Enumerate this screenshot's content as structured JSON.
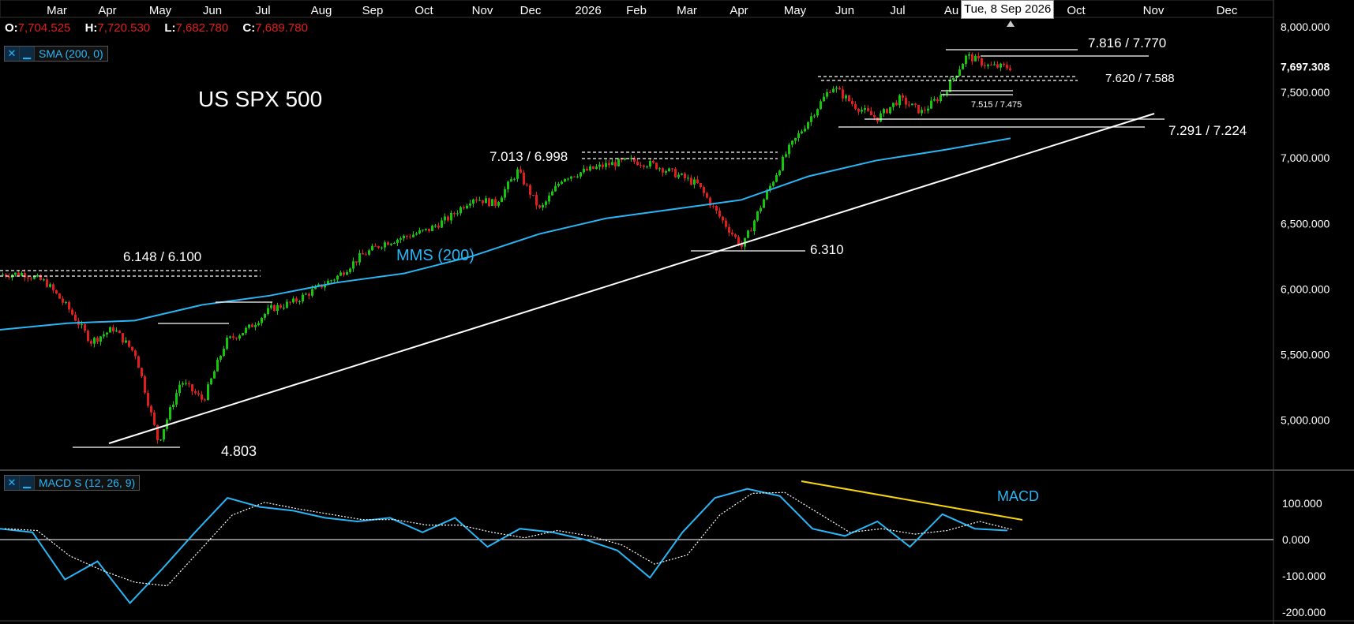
{
  "ohlc": {
    "o_label": "O:",
    "o": "7,704.525",
    "h_label": "H:",
    "h": "7,720.530",
    "l_label": "L:",
    "l": "7,682.780",
    "c_label": "C:",
    "c": "7,689.780"
  },
  "indicators": {
    "sma_label": "SMA (200, 0)",
    "macd_label": "MACD S (12, 26, 9)",
    "close_icon": "close-icon",
    "minimize_icon": "minimize-icon"
  },
  "crosshair_date": "Tue, 8 Sep 2026",
  "colors": {
    "up": "#16c60c",
    "down": "#e01e1e",
    "sma": "#29b6f6",
    "macd": "#29b6f6",
    "trend": "#ffffff",
    "divergence": "#f5d40f"
  },
  "chart_data": [
    {
      "type": "candlestick",
      "title": "US SPX 500",
      "x_ticks": [
        "Mar",
        "Apr",
        "May",
        "Jun",
        "Jul",
        "Aug",
        "Sep",
        "Oct",
        "Nov",
        "Dec",
        "2026",
        "Feb",
        "Mar",
        "Apr",
        "May",
        "Jun",
        "Jul",
        "Au",
        "Oct",
        "Nov",
        "Dec"
      ],
      "y_ticks": [
        "8,000.000",
        "7,697.308",
        "7,500.000",
        "7,000.000",
        "6,500.000",
        "6,000.000",
        "5,500.000",
        "5,000.000"
      ],
      "last_price": 7697.308,
      "ylim": [
        4730,
        8080
      ],
      "sma_label": "MMS (200)",
      "price_path": [
        [
          "Mar",
          6110
        ],
        [
          "Mar",
          6120
        ],
        [
          "Mar",
          6050
        ],
        [
          "Mar",
          5850
        ],
        [
          "Mar",
          5600
        ],
        [
          "Apr",
          5700
        ],
        [
          "Apr",
          5500
        ],
        [
          "Apr",
          4830
        ],
        [
          "Apr",
          5300
        ],
        [
          "Apr",
          5150
        ],
        [
          "May",
          5600
        ],
        [
          "May",
          5700
        ],
        [
          "May",
          5850
        ],
        [
          "Jun",
          5900
        ],
        [
          "Jun",
          6000
        ],
        [
          "Jul",
          6100
        ],
        [
          "Jul",
          6250
        ],
        [
          "Aug",
          6350
        ],
        [
          "Aug",
          6400
        ],
        [
          "Sep",
          6450
        ],
        [
          "Sep",
          6550
        ],
        [
          "Oct",
          6700
        ],
        [
          "Oct",
          6650
        ],
        [
          "Nov",
          6900
        ],
        [
          "Nov",
          6600
        ],
        [
          "Dec",
          6850
        ],
        [
          "Dec",
          6900
        ],
        [
          "2026",
          6950
        ],
        [
          "2026",
          6980
        ],
        [
          "Feb",
          6950
        ],
        [
          "Feb",
          6880
        ],
        [
          "Mar",
          6800
        ],
        [
          "Mar",
          6550
        ],
        [
          "Mar",
          6320
        ],
        [
          "Apr",
          6700
        ],
        [
          "Apr",
          7050
        ],
        [
          "May",
          7300
        ],
        [
          "May",
          7550
        ],
        [
          "Jun",
          7400
        ],
        [
          "Jun",
          7300
        ],
        [
          "Jul",
          7450
        ],
        [
          "Jul",
          7350
        ],
        [
          "Au",
          7500
        ],
        [
          "Au",
          7780
        ],
        [
          "Au",
          7700
        ],
        [
          "Au",
          7690
        ]
      ],
      "sma_path": [
        [
          "Mar",
          5690
        ],
        [
          "Apr",
          5740
        ],
        [
          "May",
          5760
        ],
        [
          "Jun",
          5880
        ],
        [
          "Jul",
          5950
        ],
        [
          "Sep",
          6050
        ],
        [
          "Nov",
          6120
        ],
        [
          "Dec",
          6250
        ],
        [
          "2026",
          6420
        ],
        [
          "Feb",
          6540
        ],
        [
          "Mar",
          6610
        ],
        [
          "Apr",
          6680
        ],
        [
          "May",
          6860
        ],
        [
          "Jun",
          6980
        ],
        [
          "Jul",
          7060
        ],
        [
          "Au",
          7150
        ]
      ],
      "levels": [
        {
          "label": "7.816 / 7.770"
        },
        {
          "label": "7.620 / 7.588"
        },
        {
          "label": "7.515 / 7.475"
        },
        {
          "label": "7.291 / 7.224"
        },
        {
          "label": "7.013 / 6.998"
        },
        {
          "label": "6.148 / 6.100"
        },
        {
          "label": "6.310"
        },
        {
          "label": "4.803"
        }
      ]
    },
    {
      "type": "line",
      "title": "MACD",
      "y_ticks": [
        "100.000",
        "0.000",
        "-100.000",
        "-200.000"
      ],
      "ylim": [
        -200,
        180
      ],
      "macd_path": [
        [
          "Mar",
          30
        ],
        [
          "Mar",
          20
        ],
        [
          "Apr",
          -110
        ],
        [
          "Apr",
          -60
        ],
        [
          "Apr",
          -175
        ],
        [
          "May",
          -80
        ],
        [
          "May",
          20
        ],
        [
          "Jun",
          115
        ],
        [
          "Jun",
          90
        ],
        [
          "Jul",
          80
        ],
        [
          "Aug",
          60
        ],
        [
          "Sep",
          50
        ],
        [
          "Oct",
          60
        ],
        [
          "Oct",
          20
        ],
        [
          "Nov",
          60
        ],
        [
          "Nov",
          -20
        ],
        [
          "Dec",
          30
        ],
        [
          "2026",
          20
        ],
        [
          "Feb",
          0
        ],
        [
          "Mar",
          -30
        ],
        [
          "Mar",
          -105
        ],
        [
          "Apr",
          20
        ],
        [
          "Apr",
          115
        ],
        [
          "May",
          140
        ],
        [
          "Jun",
          120
        ],
        [
          "Jun",
          30
        ],
        [
          "Jul",
          10
        ],
        [
          "Jul",
          50
        ],
        [
          "Au",
          -20
        ],
        [
          "Au",
          70
        ],
        [
          "Au",
          30
        ],
        [
          "Au",
          25
        ]
      ]
    }
  ]
}
